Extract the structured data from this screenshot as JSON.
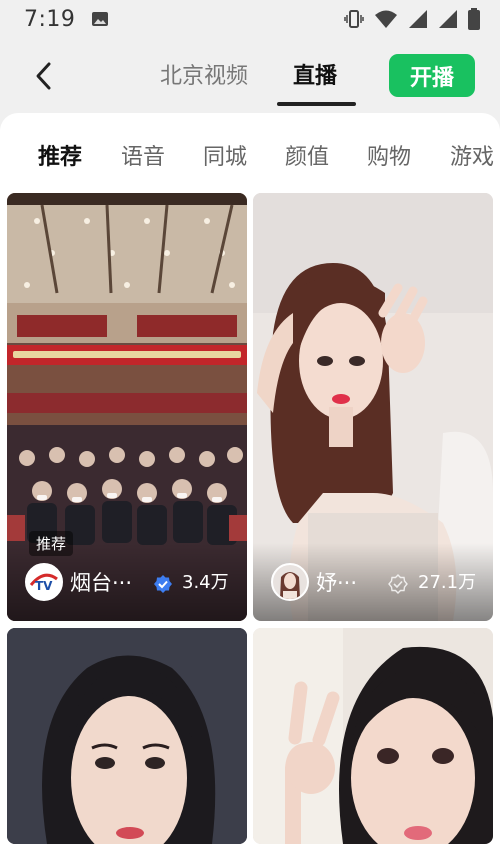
{
  "status_bar": {
    "time": "7:19",
    "icons": [
      "image-icon",
      "vibrate-icon",
      "wifi-icon",
      "signal-icon",
      "signal-icon",
      "battery-icon"
    ]
  },
  "top_nav": {
    "back_icon": "back-arrow-icon",
    "tabs": [
      {
        "label": "北京视频",
        "active": false
      },
      {
        "label": "直播",
        "active": true
      }
    ],
    "go_live_label": "开播",
    "accent_color": "#19c160"
  },
  "category_tabs": [
    {
      "label": "推荐",
      "active": true
    },
    {
      "label": "语音",
      "active": false
    },
    {
      "label": "同城",
      "active": false
    },
    {
      "label": "颜值",
      "active": false
    },
    {
      "label": "购物",
      "active": false
    },
    {
      "label": "游戏",
      "active": false
    }
  ],
  "streams": [
    {
      "badge": "推荐",
      "anchor_name": "烟台···",
      "verified": true,
      "viewers": "3.4万",
      "avatar_text": "TV"
    },
    {
      "anchor_name": "妤···",
      "verified": false,
      "viewers": "27.1万"
    },
    {},
    {}
  ]
}
